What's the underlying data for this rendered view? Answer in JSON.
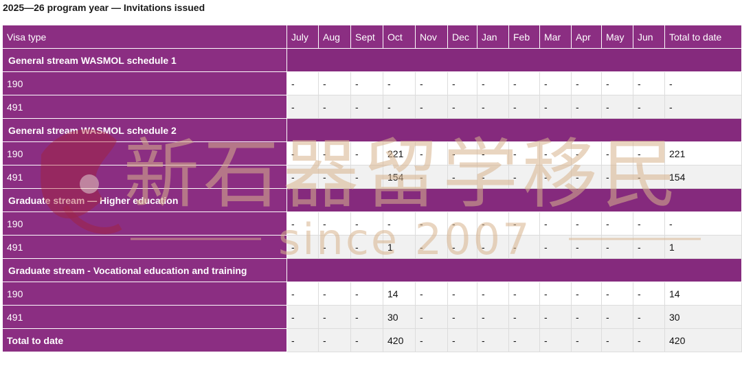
{
  "caption": "2025—26 program year — Invitations issued",
  "columns": [
    "Visa type",
    "July",
    "Aug",
    "Sept",
    "Oct",
    "Nov",
    "Dec",
    "Jan",
    "Feb",
    "Mar",
    "Apr",
    "May",
    "Jun",
    "Total to date"
  ],
  "sections": [
    {
      "title": "General stream WASMOL schedule 1",
      "rows": [
        {
          "visa": "190",
          "cells": [
            "-",
            "-",
            "-",
            "-",
            "-",
            "-",
            "-",
            "-",
            "-",
            "-",
            "-",
            "-",
            "-"
          ]
        },
        {
          "visa": "491",
          "cells": [
            "-",
            "-",
            "-",
            "-",
            "-",
            "-",
            "-",
            "-",
            "-",
            "-",
            "-",
            "-",
            "-"
          ]
        }
      ]
    },
    {
      "title": "General stream WASMOL schedule 2",
      "rows": [
        {
          "visa": "190",
          "cells": [
            "-",
            "-",
            "-",
            "221",
            "-",
            "-",
            "-",
            "-",
            "-",
            "-",
            "-",
            "-",
            "221"
          ]
        },
        {
          "visa": "491",
          "cells": [
            "-",
            "-",
            "-",
            "154",
            "-",
            "-",
            "-",
            "-",
            "-",
            "-",
            "-",
            "-",
            "154"
          ]
        }
      ]
    },
    {
      "title": "Graduate stream — Higher education",
      "rows": [
        {
          "visa": "190",
          "cells": [
            "-",
            "-",
            "-",
            "-",
            "-",
            "-",
            "-",
            "-",
            "-",
            "-",
            "-",
            "-",
            "-"
          ]
        },
        {
          "visa": "491",
          "cells": [
            "-",
            "-",
            "-",
            "1",
            "-",
            "-",
            "-",
            "-",
            "-",
            "-",
            "-",
            "-",
            "1"
          ]
        }
      ]
    },
    {
      "title": "Graduate stream - Vocational education and training",
      "rows": [
        {
          "visa": "190",
          "cells": [
            "-",
            "-",
            "-",
            "14",
            "-",
            "-",
            "-",
            "-",
            "-",
            "-",
            "-",
            "-",
            "14"
          ]
        },
        {
          "visa": "491",
          "cells": [
            "-",
            "-",
            "-",
            "30",
            "-",
            "-",
            "-",
            "-",
            "-",
            "-",
            "-",
            "-",
            "30"
          ]
        }
      ]
    }
  ],
  "total": {
    "label": "Total to date",
    "cells": [
      "-",
      "-",
      "-",
      "420",
      "-",
      "-",
      "-",
      "-",
      "-",
      "-",
      "-",
      "-",
      "420"
    ]
  },
  "watermark": {
    "text_cn": "新石器留学移民",
    "text_since": "since 2007"
  },
  "colors": {
    "header_purple": "#8b2e82",
    "row_alt": "#f1f1f1",
    "watermark": "#d8b48e"
  }
}
